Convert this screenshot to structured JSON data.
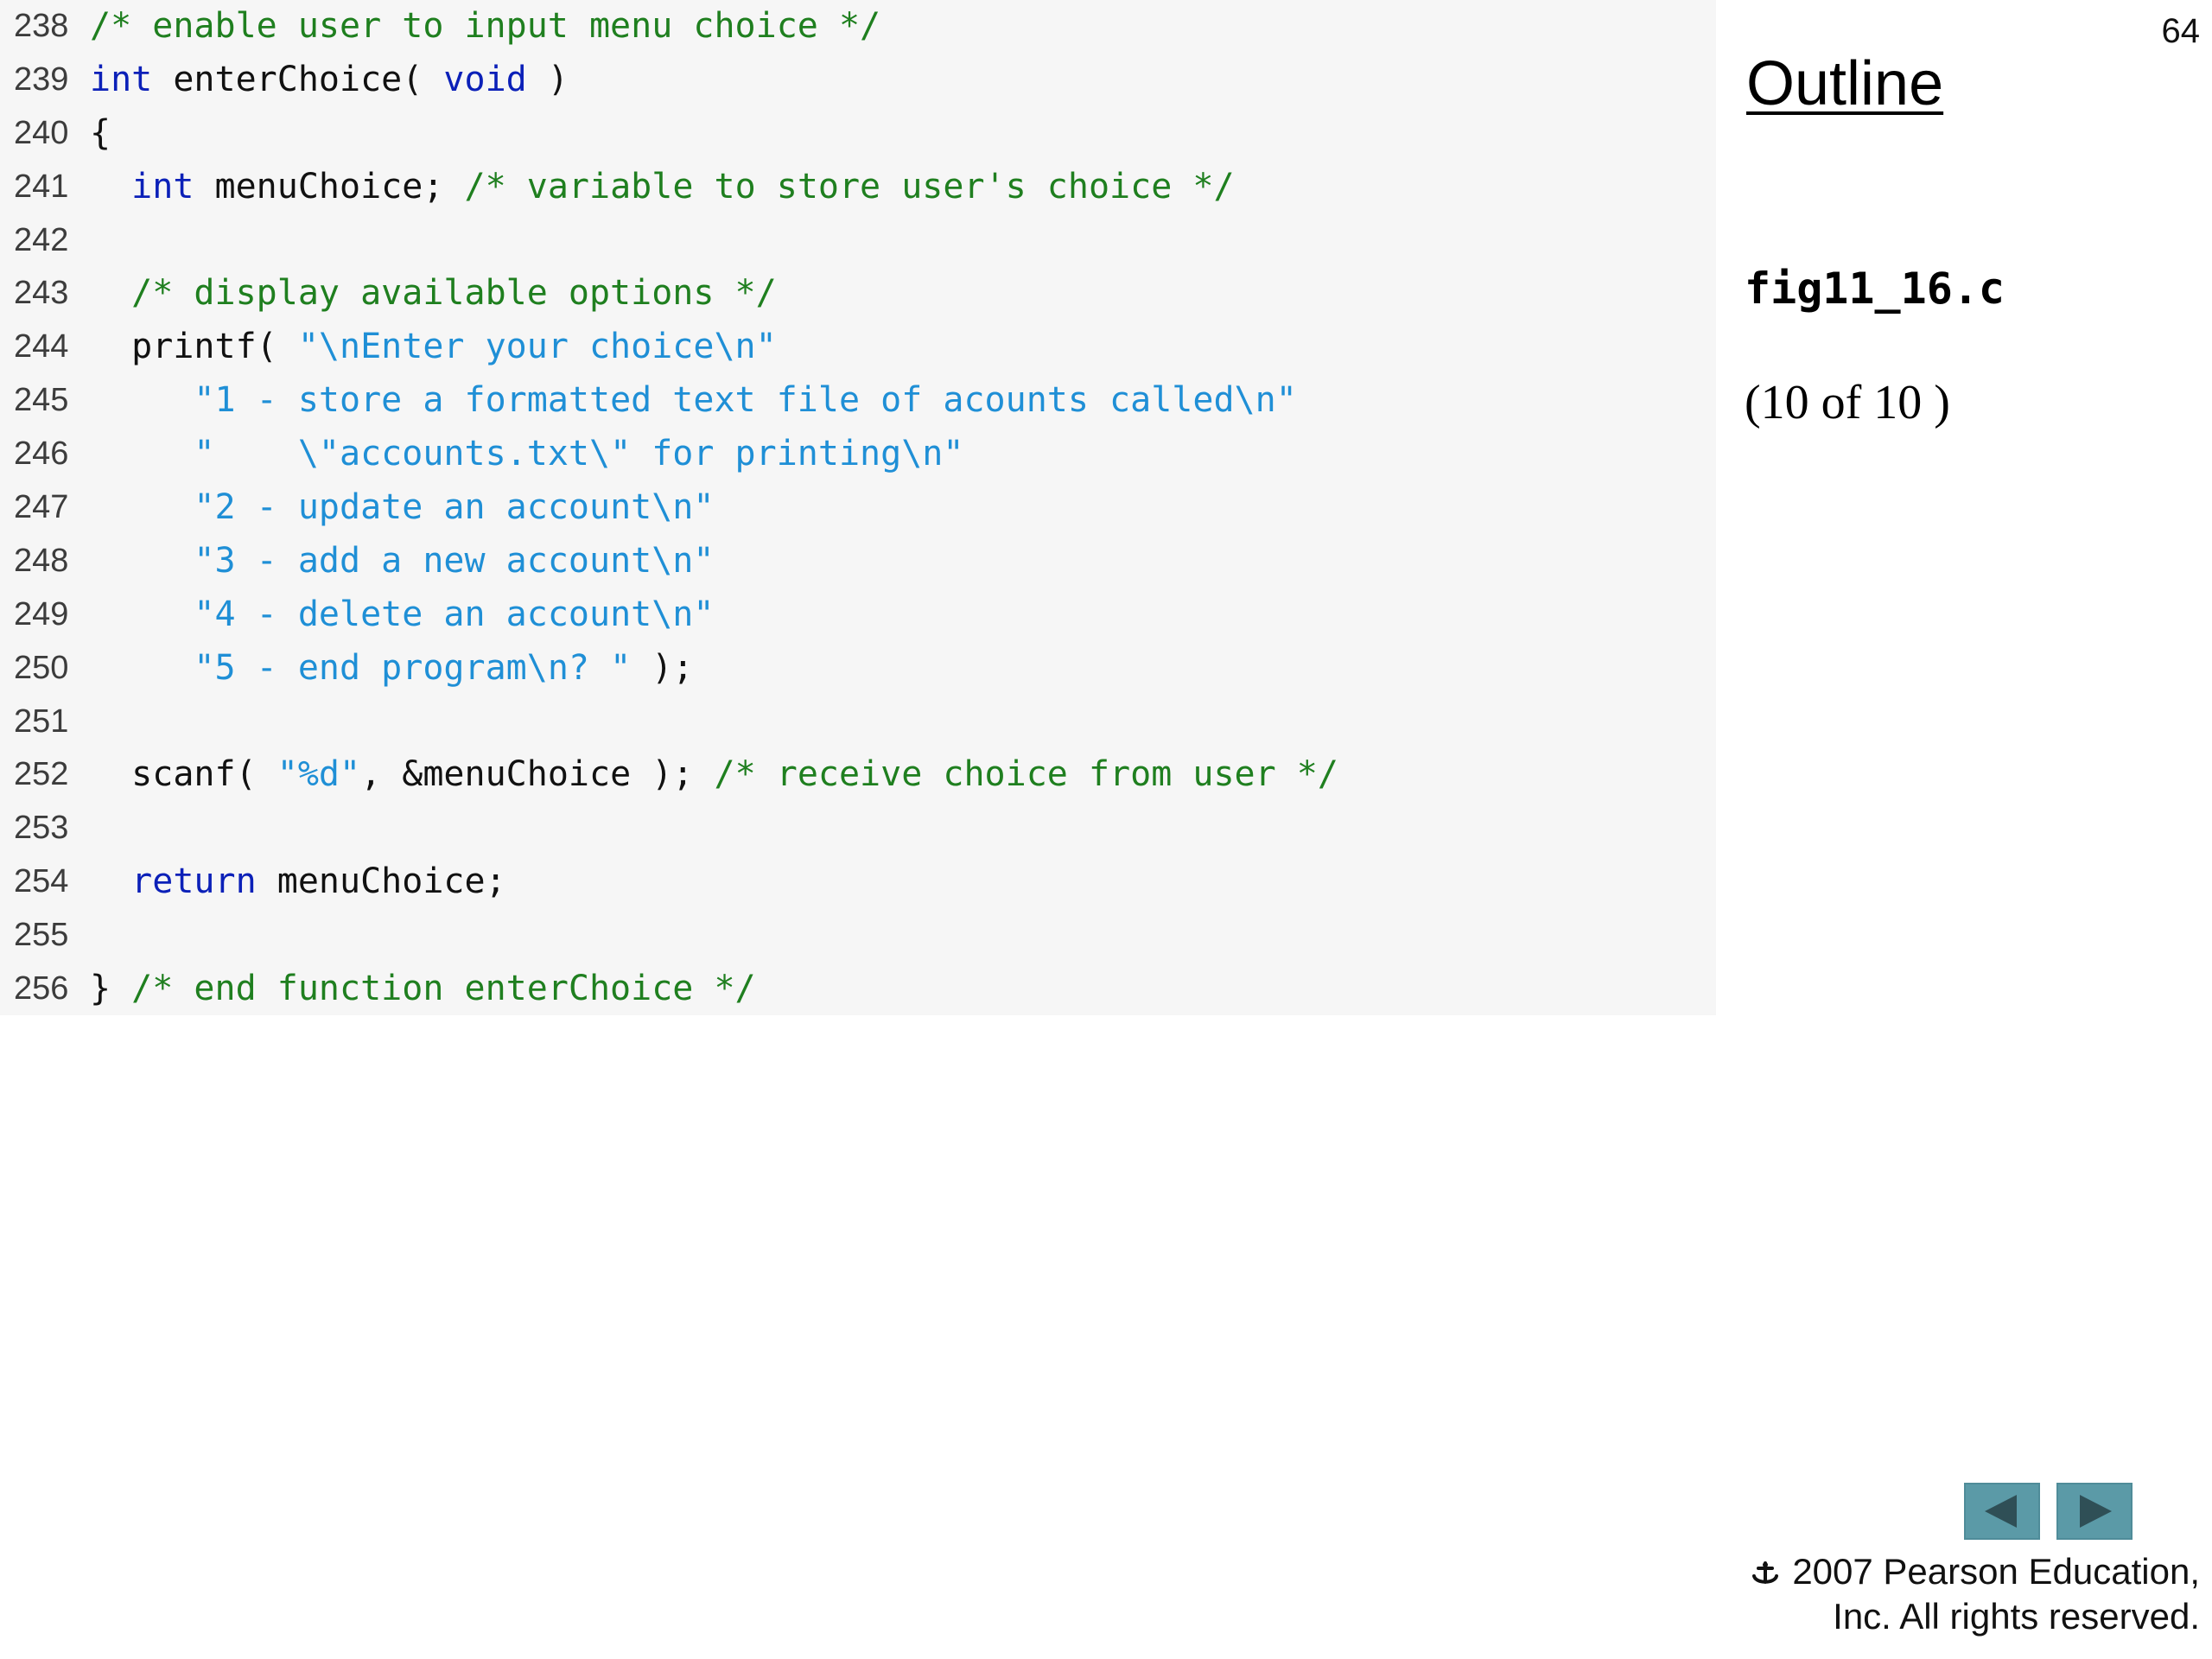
{
  "slide": {
    "number": "64",
    "outline_title": "Outline",
    "file_name": "fig11_16.c",
    "page_indicator": "(10 of 10 )"
  },
  "code": {
    "lines": [
      {
        "no": "238",
        "tokens": [
          {
            "t": "cm",
            "v": "/* enable user to input menu choice */"
          }
        ]
      },
      {
        "no": "239",
        "tokens": [
          {
            "t": "kw",
            "v": "int"
          },
          {
            "t": "pl",
            "v": " enterChoice( "
          },
          {
            "t": "kw",
            "v": "void"
          },
          {
            "t": "pl",
            "v": " )"
          }
        ]
      },
      {
        "no": "240",
        "tokens": [
          {
            "t": "pl",
            "v": "{"
          }
        ]
      },
      {
        "no": "241",
        "tokens": [
          {
            "t": "pl",
            "v": "  "
          },
          {
            "t": "kw",
            "v": "int"
          },
          {
            "t": "pl",
            "v": " menuChoice; "
          },
          {
            "t": "cm",
            "v": "/* variable to store user's choice */"
          }
        ]
      },
      {
        "no": "242",
        "tokens": []
      },
      {
        "no": "243",
        "tokens": [
          {
            "t": "pl",
            "v": "  "
          },
          {
            "t": "cm",
            "v": "/* display available options */"
          }
        ]
      },
      {
        "no": "244",
        "tokens": [
          {
            "t": "pl",
            "v": "  printf( "
          },
          {
            "t": "str",
            "v": "\"\\nEnter your choice\\n\""
          }
        ]
      },
      {
        "no": "245",
        "tokens": [
          {
            "t": "pl",
            "v": "     "
          },
          {
            "t": "str",
            "v": "\"1 - store a formatted text file of acounts called\\n\""
          }
        ]
      },
      {
        "no": "246",
        "tokens": [
          {
            "t": "pl",
            "v": "     "
          },
          {
            "t": "str",
            "v": "\"    \\\"accounts.txt\\\" for printing\\n\""
          }
        ]
      },
      {
        "no": "247",
        "tokens": [
          {
            "t": "pl",
            "v": "     "
          },
          {
            "t": "str",
            "v": "\"2 - update an account\\n\""
          }
        ]
      },
      {
        "no": "248",
        "tokens": [
          {
            "t": "pl",
            "v": "     "
          },
          {
            "t": "str",
            "v": "\"3 - add a new account\\n\""
          }
        ]
      },
      {
        "no": "249",
        "tokens": [
          {
            "t": "pl",
            "v": "     "
          },
          {
            "t": "str",
            "v": "\"4 - delete an account\\n\""
          }
        ]
      },
      {
        "no": "250",
        "tokens": [
          {
            "t": "pl",
            "v": "     "
          },
          {
            "t": "str",
            "v": "\"5 - end program\\n? \""
          },
          {
            "t": "pl",
            "v": " );"
          }
        ]
      },
      {
        "no": "251",
        "tokens": []
      },
      {
        "no": "252",
        "tokens": [
          {
            "t": "pl",
            "v": "  scanf( "
          },
          {
            "t": "str",
            "v": "\"%d\""
          },
          {
            "t": "pl",
            "v": ", &menuChoice ); "
          },
          {
            "t": "cm",
            "v": "/* receive choice from user */"
          }
        ]
      },
      {
        "no": "253",
        "tokens": []
      },
      {
        "no": "254",
        "tokens": [
          {
            "t": "pl",
            "v": "  "
          },
          {
            "t": "kw",
            "v": "return"
          },
          {
            "t": "pl",
            "v": " menuChoice;"
          }
        ]
      },
      {
        "no": "255",
        "tokens": []
      },
      {
        "no": "256",
        "tokens": [
          {
            "t": "pl",
            "v": "} "
          },
          {
            "t": "cm",
            "v": "/* end function enterChoice */"
          }
        ]
      }
    ]
  },
  "footer": {
    "line1": "2007 Pearson Education,",
    "line2": "Inc.  All rights reserved."
  },
  "nav": {
    "prev_icon": "left-triangle-icon",
    "next_icon": "right-triangle-icon"
  },
  "colors": {
    "keyword": "#0b20b8",
    "comment": "#1f7f1f",
    "string": "#1f8fd6",
    "plain": "#111111",
    "nav_button": "#5b9aa7",
    "code_background": "#f6f6f6"
  }
}
